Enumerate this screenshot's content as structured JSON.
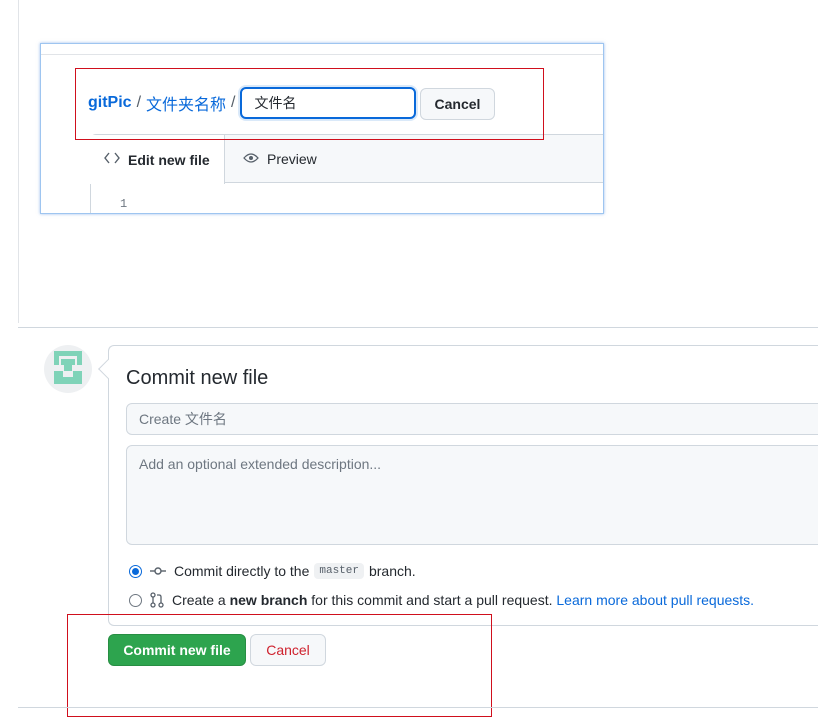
{
  "editor": {
    "repo": "gitPic",
    "folder": "文件夹名称",
    "separator": "/",
    "filename_value": "文件名",
    "cancel_label": "Cancel",
    "tab_edit": "Edit new file",
    "tab_preview": "Preview",
    "line_number": "1"
  },
  "commit": {
    "title": "Commit new file",
    "summary_placeholder": "Create 文件名",
    "description_placeholder": "Add an optional extended description...",
    "option_direct_prefix": "Commit directly to the",
    "option_direct_branch": "master",
    "option_direct_suffix": "branch.",
    "option_new_prefix": "Create a",
    "option_new_bold": "new branch",
    "option_new_suffix": "for this commit and start a pull request.",
    "option_new_link": "Learn more about pull requests.",
    "selected_option": "direct",
    "submit_label": "Commit new file",
    "cancel_label": "Cancel"
  },
  "colors": {
    "accent": "#0969da",
    "primary_button": "#2da44e",
    "danger_text": "#cf222e",
    "highlight_box": "#d00f1d"
  }
}
